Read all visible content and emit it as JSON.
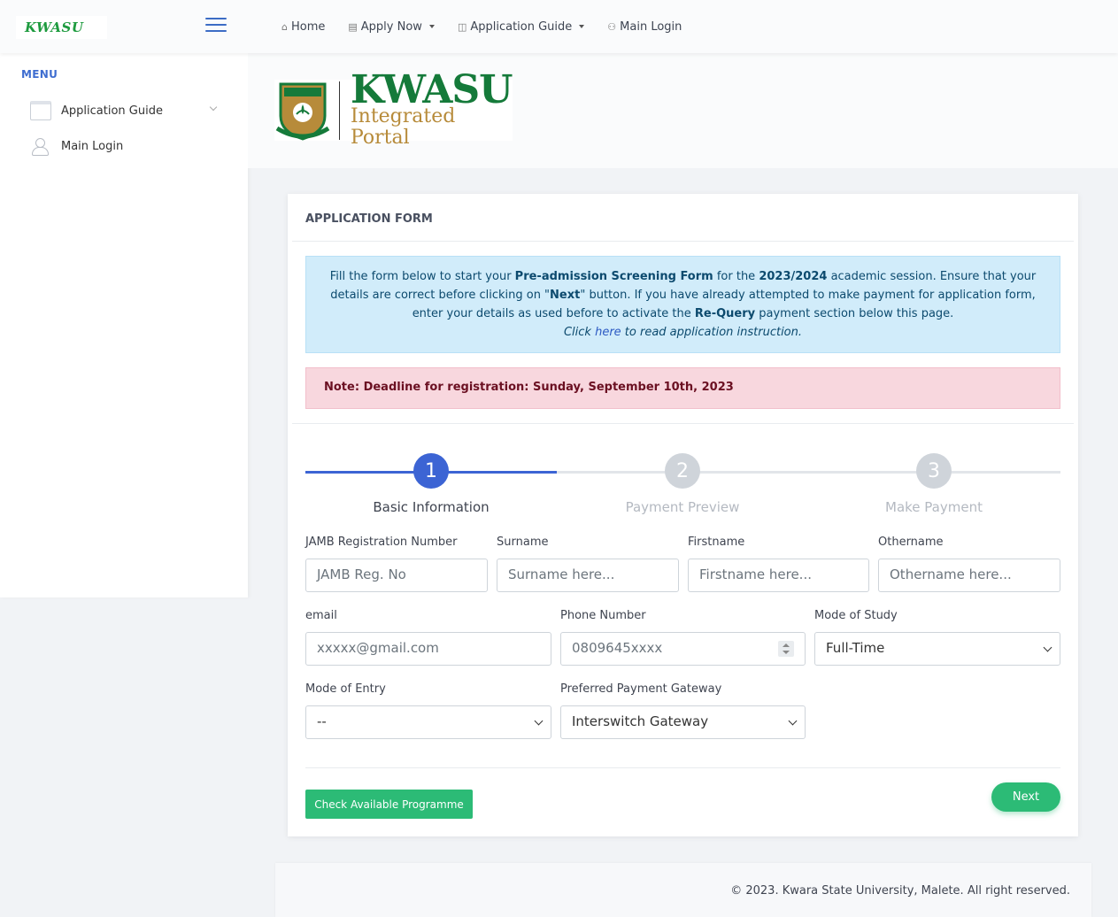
{
  "brand": {
    "name": "KWASU"
  },
  "topnav": {
    "home": "Home",
    "apply_now": "Apply Now",
    "application_guide": "Application Guide",
    "main_login": "Main Login"
  },
  "sidebar": {
    "menu_title": "MENU",
    "items": [
      {
        "label": "Application Guide",
        "icon": "calendar-icon"
      },
      {
        "label": "Main Login",
        "icon": "users-icon"
      }
    ]
  },
  "logo": {
    "main": "KWASU",
    "sub": "Integrated Portal",
    "shield_text": "KWASU"
  },
  "card": {
    "title": "APPLICATION FORM",
    "info": {
      "p1": "Fill the form below to start your ",
      "b1": "Pre-admission Screening Form",
      "p2": " for the ",
      "b2": "2023/2024",
      "p3": " academic session. Ensure that your details are correct before clicking on \"",
      "b3": "Next",
      "p4": "\" button. If you have already attempted to make payment for application form, enter your details as used before to activate the ",
      "b4": "Re-Query",
      "p5": " payment section below this page.",
      "click": "Click ",
      "here": "here",
      "click_rest": " to read application instruction."
    },
    "deadline": "Note: Deadline for registration: Sunday, September 10th, 2023"
  },
  "steps": [
    {
      "number": "1",
      "label": "Basic Information",
      "active": true
    },
    {
      "number": "2",
      "label": "Payment Preview",
      "active": false
    },
    {
      "number": "3",
      "label": "Make Payment",
      "active": false
    }
  ],
  "form": {
    "jamb": {
      "label": "JAMB Registration Number",
      "placeholder": "JAMB Reg. No"
    },
    "surname": {
      "label": "Surname",
      "placeholder": "Surname here..."
    },
    "firstname": {
      "label": "Firstname",
      "placeholder": "Firstname here..."
    },
    "othername": {
      "label": "Othername",
      "placeholder": "Othername here..."
    },
    "email": {
      "label": "email",
      "placeholder": "xxxxx@gmail.com"
    },
    "phone": {
      "label": "Phone Number",
      "placeholder": "0809645xxxx"
    },
    "mode_of_study": {
      "label": "Mode of Study",
      "value": "Full-Time"
    },
    "mode_of_entry": {
      "label": "Mode of Entry",
      "value": "--"
    },
    "payment_gateway": {
      "label": "Preferred Payment Gateway",
      "value": "Interswitch Gateway"
    }
  },
  "buttons": {
    "check_programme": "Check Available Programme",
    "next": "Next"
  },
  "footer": {
    "copyright": "© 2023. Kwara State University, Malete. All right reserved."
  },
  "colors": {
    "accent": "#3c6cc5",
    "step_active": "#3c64d4",
    "step_inactive": "#cfd4da",
    "success": "#2cbb76",
    "info_bg": "#d1ecfa",
    "danger_bg": "#f8d7de"
  }
}
